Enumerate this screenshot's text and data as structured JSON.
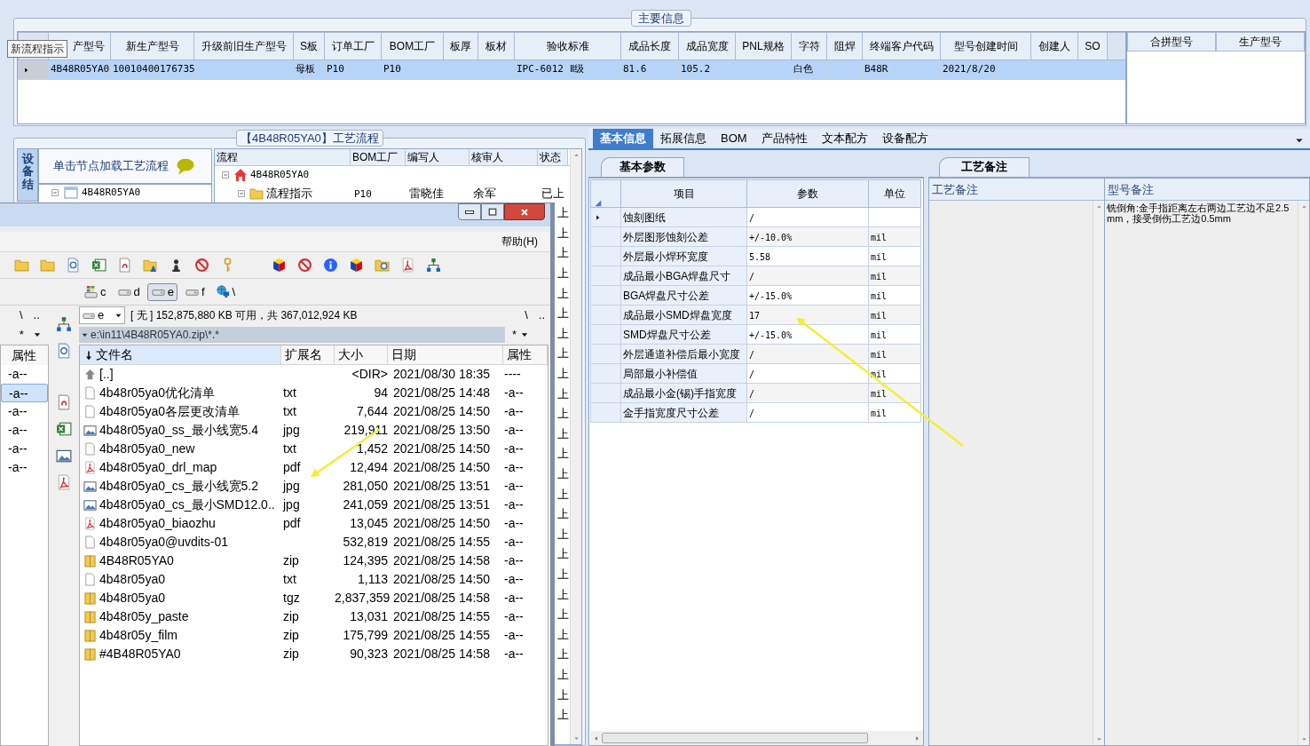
{
  "main_info": {
    "title": "主要信息",
    "columns": [
      "产型号",
      "新生产型号",
      "升级前旧生产型号",
      "S板",
      "订单工厂",
      "BOM工厂",
      "板厚",
      "板材",
      "验收标准",
      "成品长度",
      "成品宽度",
      "PNL规格",
      "字符",
      "阻焊",
      "终端客户代码",
      "型号创建时间",
      "创建人",
      "SO"
    ],
    "rows": [
      {
        "selected": true,
        "cells": [
          "4B48R05YA0",
          "10010400176735",
          null,
          "母板",
          "P10",
          "P10",
          null,
          null,
          "IPC-6012 Ⅱ级",
          "81.6",
          "105.2",
          null,
          "白色",
          null,
          "B48R",
          "2021/8/20",
          null,
          null
        ]
      }
    ],
    "side_columns": [
      "合拼型号",
      "生产型号"
    ]
  },
  "tooltip": "新流程指示",
  "flow": {
    "title": "【4B48R05YA0】工艺流程",
    "side_tab": "设备结",
    "hint": "单击节点加载工艺流程",
    "hint_tree": {
      "label": "4B48R05YA0",
      "expanded": true
    },
    "columns": [
      "流程",
      "BOM工厂",
      "编写人",
      "核审人",
      "状态"
    ],
    "tree": [
      {
        "label": "4B48R05YA0",
        "kind": "home",
        "expanded": true,
        "children": [
          {
            "label": "流程指示",
            "kind": "folder",
            "expanded": true,
            "cells": [
              "P10",
              "雷晓佳",
              "余军",
              "已上"
            ]
          }
        ]
      }
    ],
    "status_fragments": [
      "上",
      "上",
      "上",
      "上",
      "上",
      "上",
      "上",
      "上",
      "上",
      "上",
      "上",
      "上",
      "上",
      "上",
      "上",
      "上",
      "上",
      "上",
      "上",
      "上",
      "上",
      "上",
      "上",
      "上",
      "上",
      "上"
    ]
  },
  "file_manager": {
    "menu": [
      "帮助(H)"
    ],
    "drives": [
      {
        "label": "c",
        "kind": "system",
        "selected": false
      },
      {
        "label": "d",
        "kind": "disk",
        "selected": false
      },
      {
        "label": "e",
        "kind": "disk",
        "selected": true
      },
      {
        "label": "f",
        "kind": "disk",
        "selected": false
      },
      {
        "label": "\\",
        "kind": "network",
        "selected": false
      }
    ],
    "left_panel": {
      "nav": [
        "\\",
        ".."
      ],
      "filter": "*",
      "column": "属性",
      "rows": [
        {
          "attr": "-a--",
          "selected": false
        },
        {
          "attr": "-a--",
          "selected": true
        },
        {
          "attr": "-a--",
          "selected": false
        },
        {
          "attr": "-a--",
          "selected": false
        },
        {
          "attr": "-a--",
          "selected": false
        },
        {
          "attr": "-a--",
          "selected": false
        }
      ]
    },
    "drive_combo": "e",
    "free_space": "[ 无 ] 152,875,880 KB 可用，共 367,012,924 KB",
    "nav": [
      "\\",
      ".."
    ],
    "path": "e:\\in11\\4B48R05YA0.zip\\*.*",
    "filter": "*",
    "columns": [
      "文件名",
      "扩展名",
      "大小",
      "日期",
      "属性"
    ],
    "files": [
      {
        "kind": "up",
        "name": "[..]",
        "size": "<DIR>",
        "date": "2021/08/30 18:35",
        "attr": "----"
      },
      {
        "kind": "doc",
        "name": "4b48r05ya0优化清单",
        "ext": "txt",
        "size": "94",
        "date": "2021/08/25 14:48",
        "attr": "-a--"
      },
      {
        "kind": "doc",
        "name": "4b48r05ya0各层更改清单",
        "ext": "txt",
        "size": "7,644",
        "date": "2021/08/25 14:50",
        "attr": "-a--"
      },
      {
        "kind": "image",
        "name": "4b48r05ya0_ss_最小线宽5.4",
        "ext": "jpg",
        "size": "219,911",
        "date": "2021/08/25 13:50",
        "attr": "-a--"
      },
      {
        "kind": "doc",
        "name": "4b48r05ya0_new",
        "ext": "txt",
        "size": "1,452",
        "date": "2021/08/25 14:50",
        "attr": "-a--"
      },
      {
        "kind": "pdf",
        "name": "4b48r05ya0_drl_map",
        "ext": "pdf",
        "size": "12,494",
        "date": "2021/08/25 14:50",
        "attr": "-a--"
      },
      {
        "kind": "image",
        "name": "4b48r05ya0_cs_最小线宽5.2",
        "ext": "jpg",
        "size": "281,050",
        "date": "2021/08/25 13:51",
        "attr": "-a--"
      },
      {
        "kind": "image",
        "name": "4b48r05ya0_cs_最小SMD12.0..",
        "ext": "jpg",
        "size": "241,059",
        "date": "2021/08/25 13:51",
        "attr": "-a--"
      },
      {
        "kind": "pdf",
        "name": "4b48r05ya0_biaozhu",
        "ext": "pdf",
        "size": "13,045",
        "date": "2021/08/25 14:50",
        "attr": "-a--"
      },
      {
        "kind": "doc",
        "name": "4b48r05ya0@uvdits-01",
        "size": "532,819",
        "date": "2021/08/25 14:55",
        "attr": "-a--"
      },
      {
        "kind": "zip",
        "name": "4B48R05YA0",
        "ext": "zip",
        "size": "124,395",
        "date": "2021/08/25 14:58",
        "attr": "-a--"
      },
      {
        "kind": "doc",
        "name": "4b48r05ya0",
        "ext": "txt",
        "size": "1,113",
        "date": "2021/08/25 14:50",
        "attr": "-a--"
      },
      {
        "kind": "zip",
        "name": "4b48r05ya0",
        "ext": "tgz",
        "size": "2,837,359",
        "date": "2021/08/25 14:58",
        "attr": "-a--"
      },
      {
        "kind": "zip",
        "name": "4b48r05y_paste",
        "ext": "zip",
        "size": "13,031",
        "date": "2021/08/25 14:55",
        "attr": "-a--"
      },
      {
        "kind": "zip",
        "name": "4b48r05y_film",
        "ext": "zip",
        "size": "175,799",
        "date": "2021/08/25 14:55",
        "attr": "-a--"
      },
      {
        "kind": "zip",
        "name": "#4B48R05YA0",
        "ext": "zip",
        "size": "90,323",
        "date": "2021/08/25 14:58",
        "attr": "-a--"
      }
    ]
  },
  "detail": {
    "tabs": [
      {
        "label": "基本信息",
        "selected": true
      },
      {
        "label": "拓展信息",
        "selected": false
      },
      {
        "label": "BOM",
        "selected": false
      },
      {
        "label": "产品特性",
        "selected": false
      },
      {
        "label": "文本配方",
        "selected": false
      },
      {
        "label": "设备配方",
        "selected": false
      }
    ],
    "params": {
      "tab": "基本参数",
      "columns": [
        "项目",
        "参数",
        "单位"
      ],
      "rows": [
        {
          "item": "蚀刻图纸",
          "value": "/",
          "selected": true
        },
        {
          "item": "外层图形蚀刻公差",
          "value": "+/-10.0%",
          "unit": "mil",
          "selected": false
        },
        {
          "item": "外层最小焊环宽度",
          "value": "5.58",
          "unit": "mil",
          "selected": false
        },
        {
          "item": "成品最小BGA焊盘尺寸",
          "value": "/",
          "unit": "mil",
          "selected": false
        },
        {
          "item": "BGA焊盘尺寸公差",
          "value": "+/-15.0%",
          "unit": "mil",
          "selected": false
        },
        {
          "item": "成品最小SMD焊盘宽度",
          "value": "17",
          "unit": "mil",
          "selected": false
        },
        {
          "item": "SMD焊盘尺寸公差",
          "value": "+/-15.0%",
          "unit": "mil",
          "selected": false
        },
        {
          "item": "外层通道补偿后最小宽度",
          "value": "/",
          "unit": "mil",
          "selected": false
        },
        {
          "item": "局部最小补偿值",
          "value": "/",
          "unit": "mil",
          "selected": false
        },
        {
          "item": "成品最小金(锡)手指宽度",
          "value": "/",
          "unit": "mil",
          "selected": false
        },
        {
          "item": "金手指宽度尺寸公差",
          "value": "/",
          "unit": "mil",
          "selected": false
        }
      ]
    },
    "notes": {
      "tab": "工艺备注",
      "columns": [
        "工艺备注",
        "型号备注"
      ],
      "model_note": "铣倒角:金手指距离左右两边工艺边不足2.5mm，接受倒伤工艺边0.5mm"
    }
  }
}
